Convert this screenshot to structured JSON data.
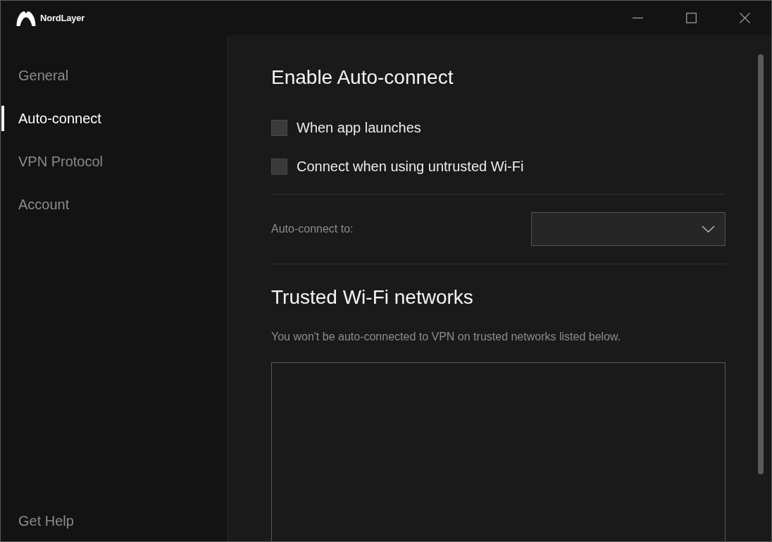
{
  "window": {
    "title": "NordLayer"
  },
  "sidebar": {
    "items": [
      {
        "label": "General",
        "selected": false
      },
      {
        "label": "Auto-connect",
        "selected": true
      },
      {
        "label": "VPN Protocol",
        "selected": false
      },
      {
        "label": "Account",
        "selected": false
      }
    ],
    "footer_link": "Get Help"
  },
  "auto_connect": {
    "title": "Enable Auto-connect",
    "options": [
      {
        "label": "When app launches",
        "checked": false
      },
      {
        "label": "Connect when using untrusted Wi-Fi",
        "checked": false
      }
    ],
    "target": {
      "label": "Auto-connect to:"
    }
  },
  "trusted_networks": {
    "title": "Trusted Wi-Fi networks",
    "description": "You won't be auto-connected to VPN on trusted networks listed below."
  }
}
